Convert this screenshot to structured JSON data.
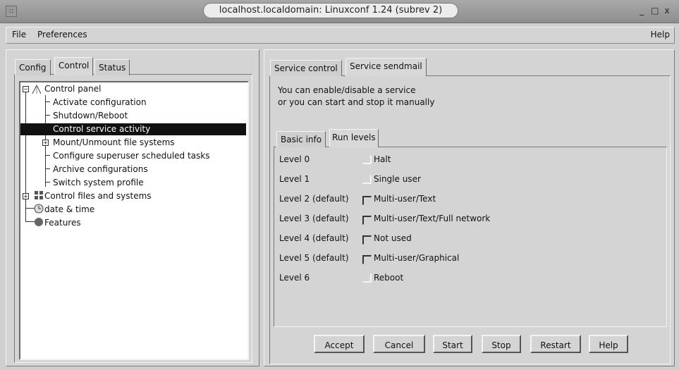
{
  "window": {
    "title": "localhost.localdomain: Linuxconf 1.24 (subrev 2)",
    "sys_menu_glyph": "::",
    "controls": [
      "_",
      "□",
      "x"
    ]
  },
  "menubar": {
    "file": "File",
    "preferences": "Preferences",
    "help": "Help"
  },
  "left_tabs": [
    "Config",
    "Control",
    "Status"
  ],
  "tree": [
    {
      "label": "Control panel"
    },
    {
      "label": "Activate configuration"
    },
    {
      "label": "Shutdown/Reboot"
    },
    {
      "label": "Control service activity"
    },
    {
      "label": "Mount/Unmount file systems"
    },
    {
      "label": "Configure superuser scheduled tasks"
    },
    {
      "label": "Archive configurations"
    },
    {
      "label": "Switch system profile"
    },
    {
      "label": "Control files and systems"
    },
    {
      "label": "date & time"
    },
    {
      "label": "Features"
    }
  ],
  "right_tabs": [
    "Service control",
    "Service sendmail"
  ],
  "description": {
    "line1": "You can enable/disable a service",
    "line2": "or you can start and stop it manually"
  },
  "inner_tabs": [
    "Basic info",
    "Run levels"
  ],
  "run_levels": [
    {
      "level": "Level 0",
      "checked": false,
      "desc": "Halt"
    },
    {
      "level": "Level 1",
      "checked": false,
      "desc": "Single user"
    },
    {
      "level": "Level 2 (default)",
      "checked": true,
      "desc": "Multi-user/Text"
    },
    {
      "level": "Level 3 (default)",
      "checked": true,
      "desc": "Multi-user/Text/Full network"
    },
    {
      "level": "Level 4 (default)",
      "checked": true,
      "desc": "Not used"
    },
    {
      "level": "Level 5 (default)",
      "checked": true,
      "desc": "Multi-user/Graphical"
    },
    {
      "level": "Level 6",
      "checked": false,
      "desc": "Reboot"
    }
  ],
  "buttons": {
    "accept": "Accept",
    "cancel": "Cancel",
    "start": "Start",
    "stop": "Stop",
    "restart": "Restart",
    "help": "Help"
  }
}
